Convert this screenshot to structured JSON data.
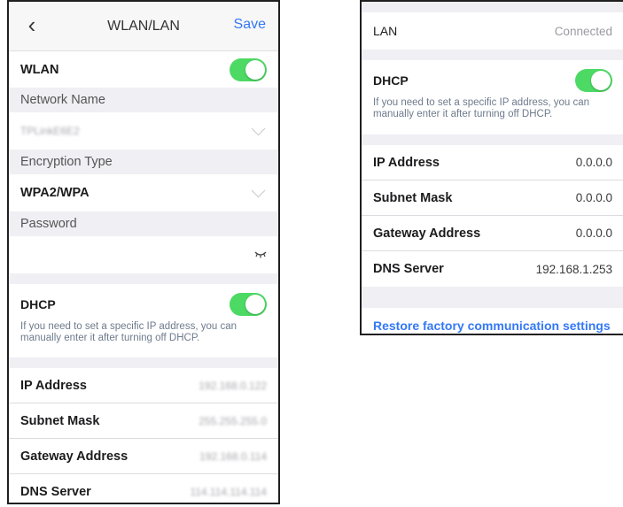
{
  "left": {
    "nav": {
      "title": "WLAN/LAN",
      "save_label": "Save"
    },
    "wlan_label": "WLAN",
    "network_name_label": "Network Name",
    "network_name_value": "TPLinkE6E2",
    "encryption_label": "Encryption Type",
    "encryption_value": "WPA2/WPA",
    "password_label": "Password",
    "dhcp_label": "DHCP",
    "dhcp_hint": "If you need to set a specific IP address, you can manually enter it after turning off DHCP.",
    "rows": [
      {
        "label": "IP Address",
        "value": "192.168.0.122"
      },
      {
        "label": "Subnet Mask",
        "value": "255.255.255.0"
      },
      {
        "label": "Gateway Address",
        "value": "192.168.0.114"
      },
      {
        "label": "DNS Server",
        "value": "114.114.114.114"
      }
    ]
  },
  "right": {
    "lan_label": "LAN",
    "lan_status": "Connected",
    "dhcp_label": "DHCP",
    "dhcp_hint": "If you need to set a specific IP address, you can manually enter it after turning off DHCP.",
    "rows": [
      {
        "label": "IP Address",
        "value": "0.0.0.0"
      },
      {
        "label": "Subnet Mask",
        "value": "0.0.0.0"
      },
      {
        "label": "Gateway Address",
        "value": "0.0.0.0"
      },
      {
        "label": "DNS Server",
        "value": "192.168.1.253"
      }
    ],
    "restore_label": "Restore factory communication settings"
  },
  "colors": {
    "accent": "#3478f6",
    "toggle_on": "#4cd964",
    "background": "#efeff4"
  },
  "toggles": {
    "wlan": "on",
    "left_dhcp": "on",
    "right_dhcp": "on"
  }
}
